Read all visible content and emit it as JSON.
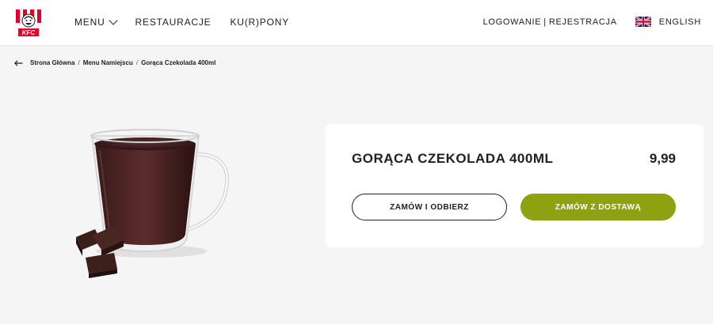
{
  "header": {
    "logo_text": "KFC",
    "nav": {
      "menu_label": "MENU",
      "restaurants_label": "RESTAURACJE",
      "coupons_label": "KU(R)PONY"
    },
    "login_label": "LOGOWANIE",
    "separator": "|",
    "register_label": "REJESTRACJA",
    "language_label": "ENGLISH",
    "language_flag": "uk-flag-icon"
  },
  "breadcrumb": {
    "items": [
      "Strona Główna",
      "Menu Namiejscu",
      "Gorąca Czekolada 400ml"
    ],
    "separator": "/"
  },
  "product": {
    "name": "GORĄCA CZEKOLADA 400ML",
    "price": "9,99",
    "pickup_button": "ZAMÓW I ODBIERZ",
    "delivery_button": "ZAMÓW Z DOSTAWĄ"
  },
  "colors": {
    "brand_red": "#e4002b",
    "delivery_green": "#8ca20f",
    "page_background": "#f5f5f5"
  }
}
